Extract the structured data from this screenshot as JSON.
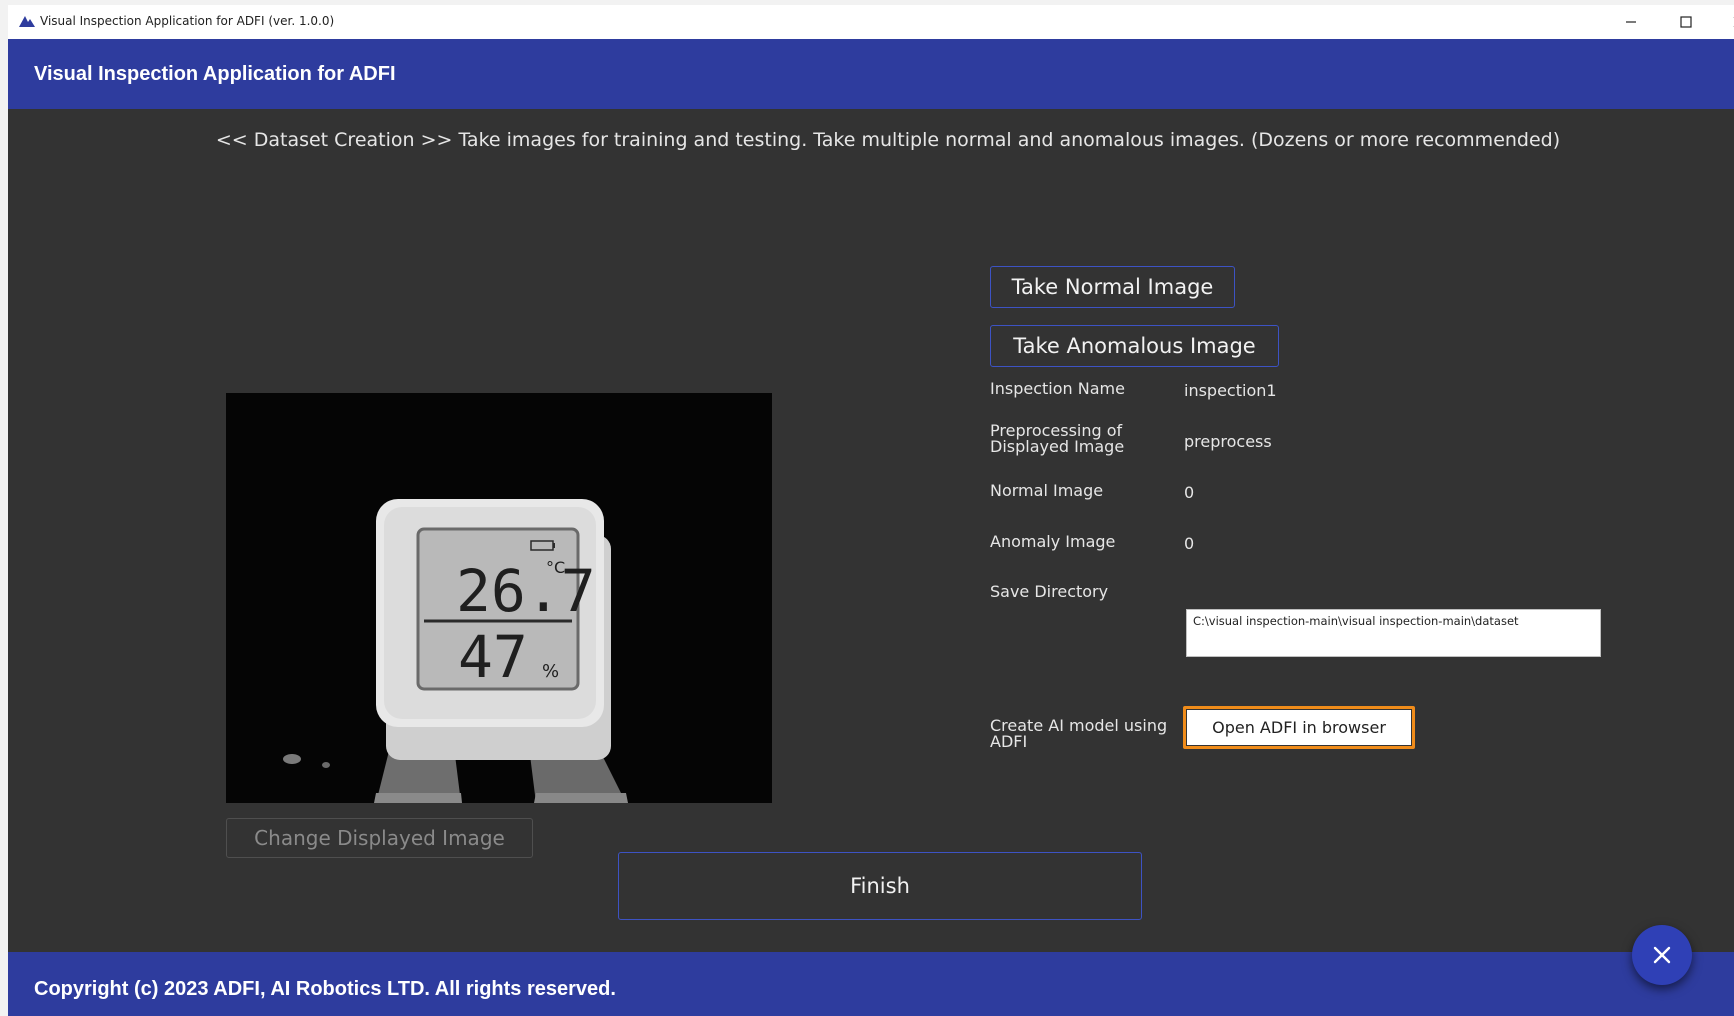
{
  "window": {
    "title": "Visual Inspection Application for ADFI (ver. 1.0.0)"
  },
  "header": {
    "title": "Visual Inspection Application for ADFI"
  },
  "instruction": "<< Dataset Creation >>  Take images for training and testing. Take multiple normal and anomalous images. (Dozens or more recommended)",
  "buttons": {
    "take_normal": "Take Normal Image",
    "take_anomalous": "Take Anomalous Image",
    "change_displayed": "Change Displayed Image",
    "open_adfi": "Open ADFI in browser",
    "finish": "Finish"
  },
  "info": {
    "inspection_name_label": "Inspection Name",
    "inspection_name_value": "inspection1",
    "preprocessing_label_line1": "Preprocessing of",
    "preprocessing_label_line2": "Displayed Image",
    "preprocessing_value": "preprocess",
    "normal_image_label": "Normal Image",
    "normal_image_value": "0",
    "anomaly_image_label": "Anomaly Image",
    "anomaly_image_value": "0",
    "save_directory_label": "Save Directory",
    "save_directory_value": "C:\\visual inspection-main\\visual inspection-main\\dataset",
    "create_ai_label_line1": "Create AI model using",
    "create_ai_label_line2": "ADFI"
  },
  "preview": {
    "temperature": "26.7",
    "temperature_unit": "°C",
    "humidity": "47",
    "humidity_unit": "%"
  },
  "footer": {
    "copyright": "Copyright (c) 2023 ADFI, AI Robotics LTD. All rights reserved."
  },
  "colors": {
    "accent_blue": "#2e3c9e",
    "button_border": "#3d53c4",
    "highlight_orange": "#f08c1a",
    "background_dark": "#333333"
  }
}
